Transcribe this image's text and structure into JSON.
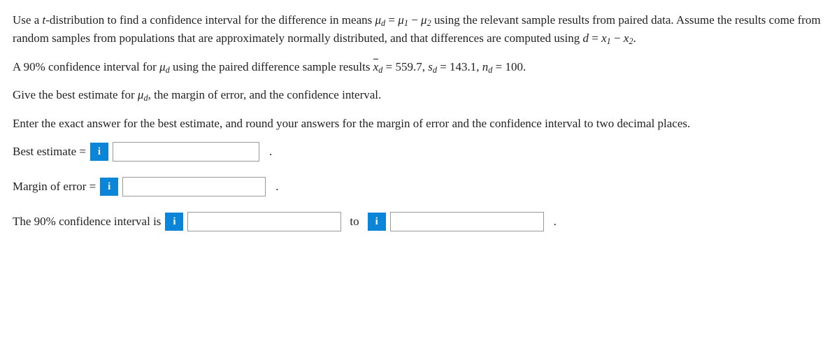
{
  "p1a": "Use a ",
  "p1b": "-distribution to find a confidence interval for the difference in means ",
  "p1c": " using the relevant sample results from paired data. Assume the results come from random samples from populations that are approximately normally distributed, and that differences are computed using ",
  "p1d": ".",
  "p2a": "A 90% confidence interval for ",
  "p2b": " using the paired difference sample results ",
  "p2c": ".",
  "vals": {
    "xdbar": "559.7",
    "sd": "143.1",
    "nd": "100"
  },
  "p3a": "Give the best estimate for ",
  "p3b": ", the margin of error, and the confidence interval.",
  "p4": "Enter the exact answer for the best estimate, and round your answers for the margin of error and the confidence interval to two decimal places.",
  "labels": {
    "best": "Best estimate =",
    "moe": "Margin of error =",
    "ci_pre": "The 90% confidence interval is",
    "to": "to"
  },
  "dot": "."
}
